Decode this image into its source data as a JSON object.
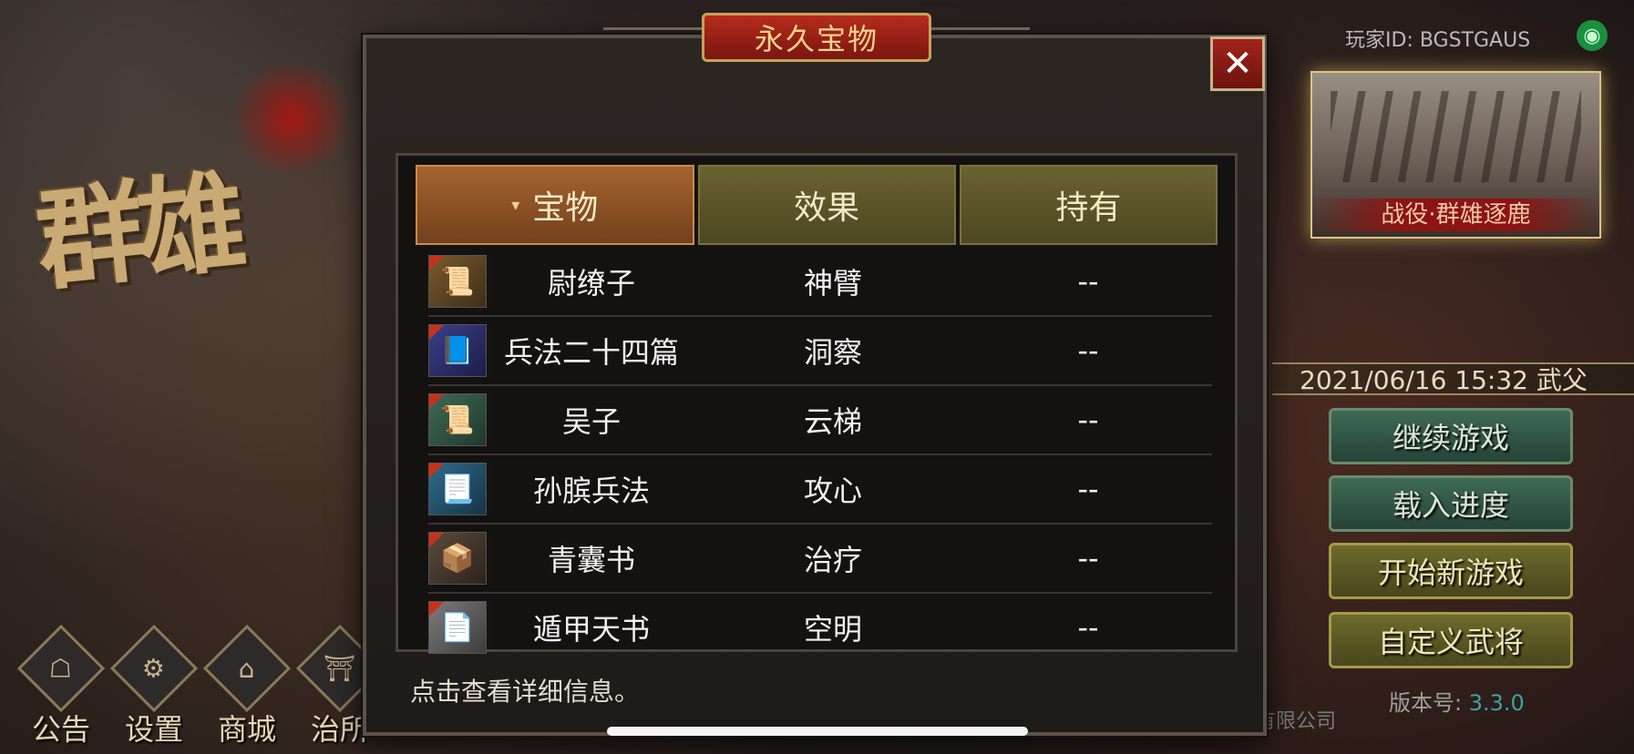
{
  "background": {
    "logo_text": "群雄"
  },
  "menu": [
    {
      "label": "公告",
      "icon": "notice-icon",
      "glyph": "☖"
    },
    {
      "label": "设置",
      "icon": "gear-icon",
      "glyph": "⚙"
    },
    {
      "label": "商城",
      "icon": "shop-icon",
      "glyph": "⌂"
    },
    {
      "label": "治所",
      "icon": "palace-icon",
      "glyph": "⛩"
    }
  ],
  "player": {
    "id_label": "玩家ID: BGSTGAUS"
  },
  "campaign": {
    "banner": "战役·群雄逐鹿"
  },
  "save": {
    "datetime": "2021/06/16 15:32 武父"
  },
  "right_buttons": {
    "continue": "继续游戏",
    "load": "载入进度",
    "new_game": "开始新游戏",
    "custom_general": "自定义武将"
  },
  "version": {
    "label": "版本号:",
    "value": "3.3.0"
  },
  "company": "有限公司",
  "modal": {
    "title": "永久宝物",
    "close_glyph": "✕",
    "columns": [
      "宝物",
      "效果",
      "持有"
    ],
    "sorted_column_indicator": "▾",
    "items": [
      {
        "name": "尉缭子",
        "effect": "神臂",
        "owned": "--",
        "icon": "book-icon",
        "glyph": "📜"
      },
      {
        "name": "兵法二十四篇",
        "effect": "洞察",
        "owned": "--",
        "icon": "blue-book-icon",
        "glyph": "📘"
      },
      {
        "name": "吴子",
        "effect": "云梯",
        "owned": "--",
        "icon": "scroll-icon",
        "glyph": "📜"
      },
      {
        "name": "孙膑兵法",
        "effect": "攻心",
        "owned": "--",
        "icon": "open-scroll-icon",
        "glyph": "📃"
      },
      {
        "name": "青囊书",
        "effect": "治疗",
        "owned": "--",
        "icon": "bag-icon",
        "glyph": "📦"
      },
      {
        "name": "遁甲天书",
        "effect": "空明",
        "owned": "--",
        "icon": "celestial-scroll-icon",
        "glyph": "📄"
      }
    ],
    "hint": "点击查看详细信息。"
  }
}
